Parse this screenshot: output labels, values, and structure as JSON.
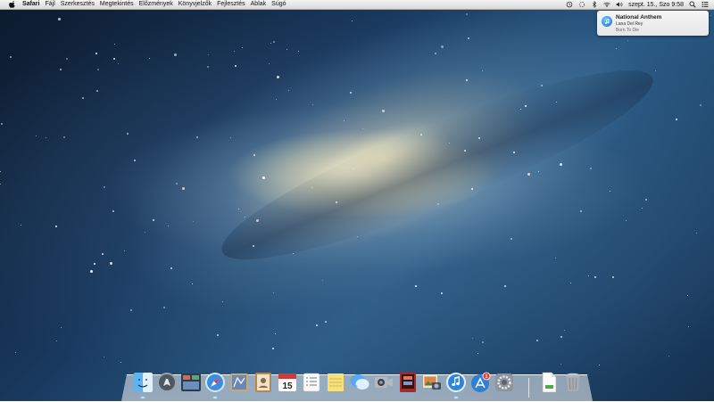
{
  "menubar": {
    "apple_icon": "apple-icon",
    "app_name": "Safari",
    "items": [
      "Fájl",
      "Szerkesztés",
      "Megtekintés",
      "Előzmények",
      "Könyvjelzők",
      "Fejlesztés",
      "Ablak",
      "Súgó"
    ],
    "status": {
      "icons": [
        "timemachine-icon",
        "spinner-icon",
        "bluetooth-icon",
        "wifi-icon",
        "volume-icon"
      ],
      "clock": "szept. 15., Szo  9:58",
      "search_icon": "spotlight-search-icon",
      "notification_icon": "notification-center-icon"
    }
  },
  "notification": {
    "title": "National Anthem",
    "subtitle": "Lana Del Rey",
    "body": "Born To Die",
    "icon": "itunes-icon"
  },
  "dock": {
    "apps": [
      {
        "icon": "finder-icon",
        "running": true
      },
      {
        "icon": "launchpad-icon",
        "running": false
      },
      {
        "icon": "mission-control-icon",
        "running": false
      },
      {
        "icon": "safari-icon",
        "running": true
      },
      {
        "icon": "mail-icon",
        "running": false
      },
      {
        "icon": "contacts-icon",
        "running": false
      },
      {
        "icon": "calendar-icon",
        "running": false,
        "label": "15"
      },
      {
        "icon": "reminders-icon",
        "running": false
      },
      {
        "icon": "notes-icon",
        "running": false
      },
      {
        "icon": "messages-icon",
        "running": false
      },
      {
        "icon": "facetime-icon",
        "running": false
      },
      {
        "icon": "photo-booth-icon",
        "running": false
      },
      {
        "icon": "iphoto-icon",
        "running": false
      },
      {
        "icon": "itunes-icon",
        "running": true
      },
      {
        "icon": "app-store-icon",
        "running": false,
        "badge": "1"
      },
      {
        "icon": "system-preferences-icon",
        "running": false
      }
    ],
    "right": [
      {
        "icon": "document-icon"
      },
      {
        "icon": "trash-icon"
      }
    ]
  }
}
